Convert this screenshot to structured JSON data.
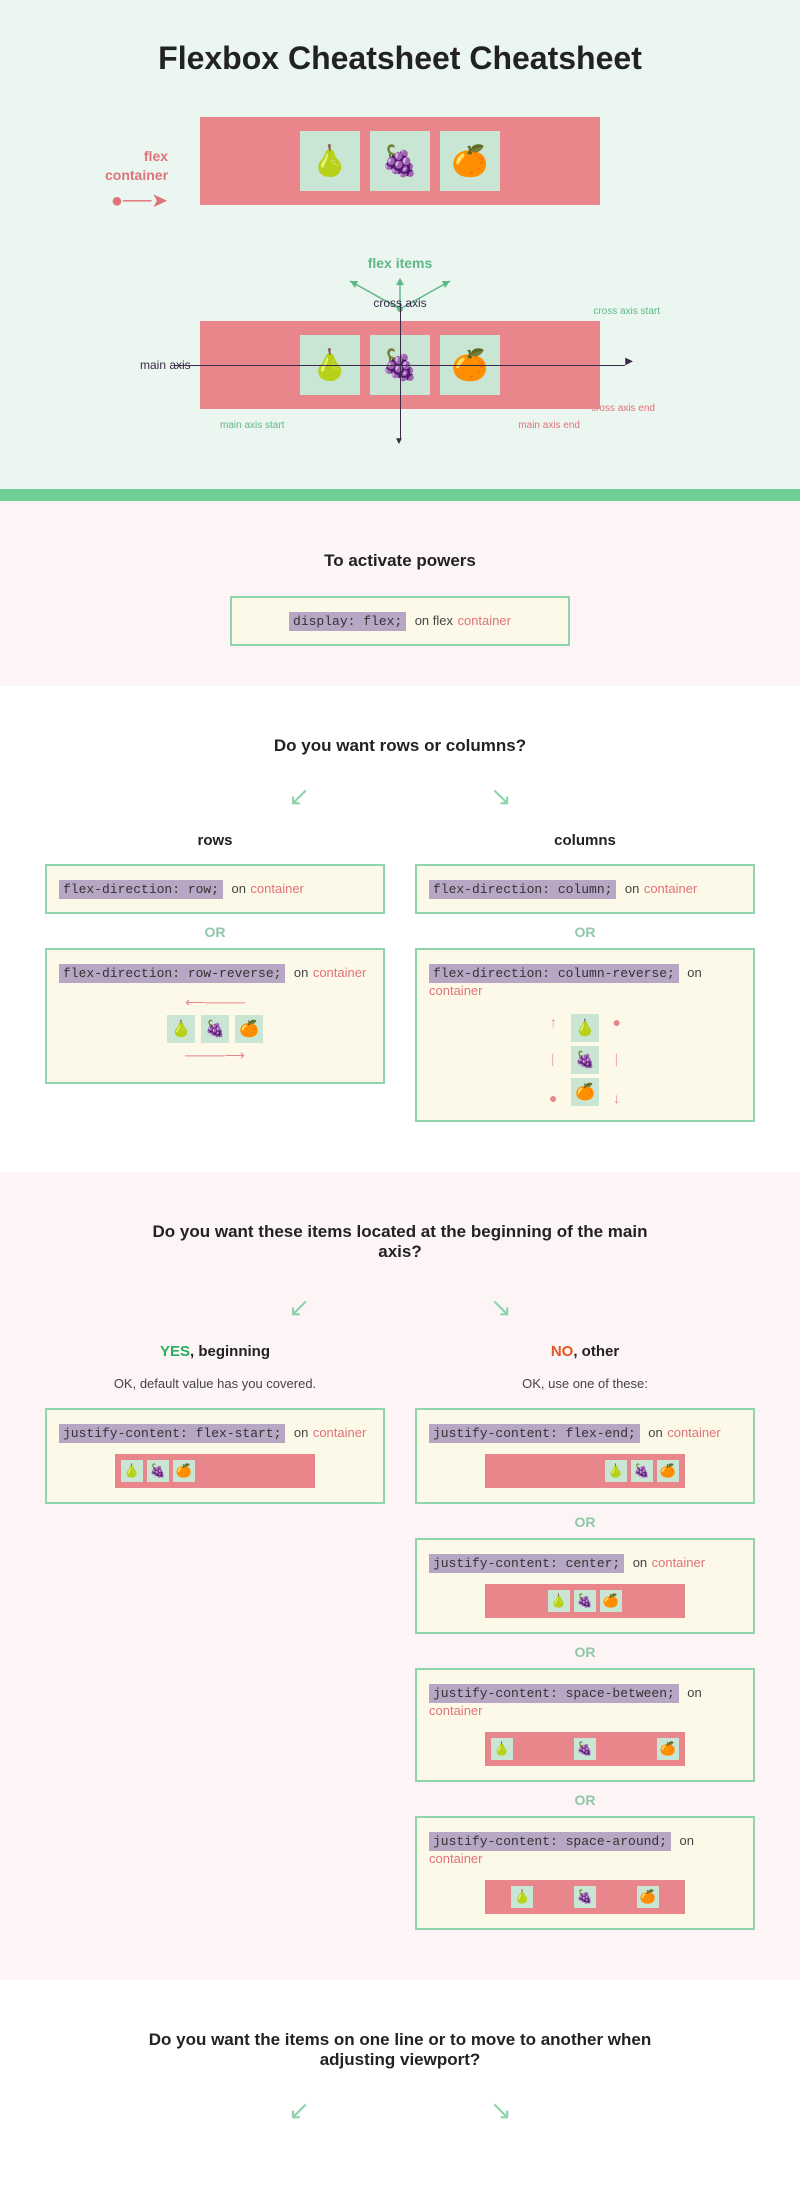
{
  "title": "Flexbox Cheatsheet Cheatsheet",
  "diagram1": {
    "container_label": "flex\ncontainer",
    "items_label": "flex items"
  },
  "diagram2": {
    "main_axis": "main axis",
    "cross_axis": "cross axis",
    "cross_start": "cross axis start",
    "cross_end": "cross axis end",
    "main_start": "main axis start",
    "main_end": "main axis end"
  },
  "activate": {
    "heading": "To activate powers",
    "code": "display: flex;",
    "on": "on flex",
    "target": "container"
  },
  "rows_cols": {
    "heading": "Do you want rows or columns?",
    "rows_label": "rows",
    "cols_label": "columns",
    "row_code": "flex-direction: row;",
    "row_rev_code": "flex-direction: row-reverse;",
    "col_code": "flex-direction: column;",
    "col_rev_code": "flex-direction: column-reverse;",
    "on": "on",
    "target": "container",
    "or": "OR"
  },
  "justify": {
    "heading": "Do you want these items located at the beginning of the main axis?",
    "yes": "YES",
    "yes_suffix": ",  beginning",
    "no": "NO",
    "no_suffix": ", other",
    "yes_sub": "OK, default value has you covered.",
    "no_sub": "OK, use one of these:",
    "fs_code": "justify-content: flex-start;",
    "fe_code": "justify-content: flex-end;",
    "ce_code": "justify-content: center;",
    "sb_code": "justify-content: space-between;",
    "sa_code": "justify-content: space-around;",
    "on": "on",
    "target": "container",
    "or": "OR"
  },
  "wrap": {
    "heading": "Do you want the items on one line or to move to another when adjusting viewport?"
  }
}
